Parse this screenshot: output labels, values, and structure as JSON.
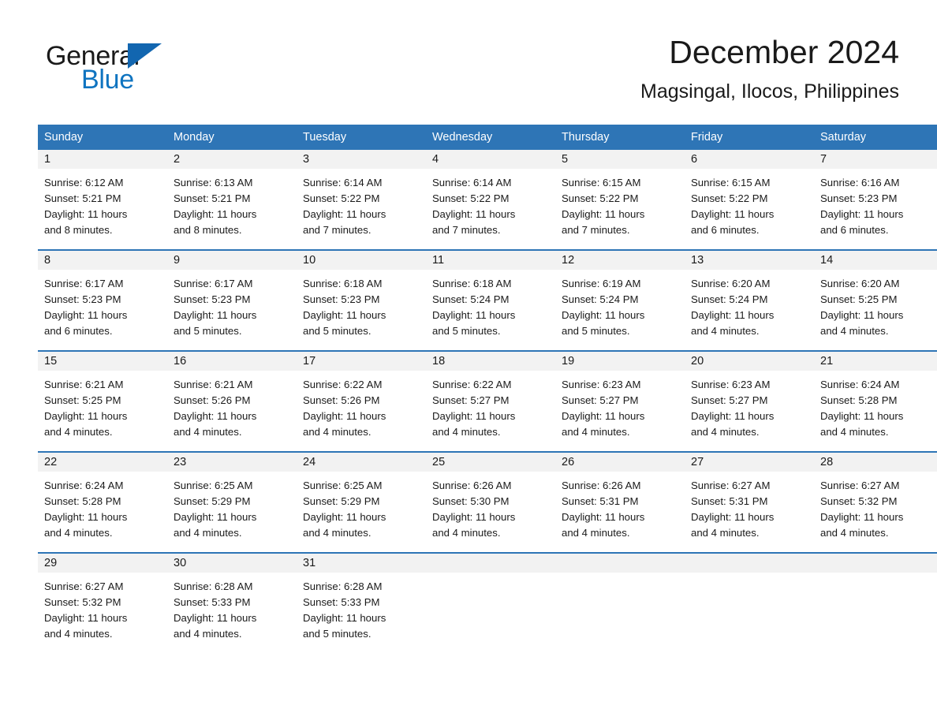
{
  "brand": {
    "name_part1": "General",
    "name_part2": "Blue",
    "triangle_color": "#1266b0",
    "blue_text_color": "#0f74c0"
  },
  "header": {
    "month_year": "December 2024",
    "location": "Magsingal, Ilocos, Philippines"
  },
  "theme": {
    "header_blue": "#2e75b6",
    "row_divider_blue": "#2e75b6",
    "daynum_band_gray": "#f2f2f2",
    "text_color": "#1a1a1a",
    "page_background": "#ffffff"
  },
  "calendar": {
    "weekday_headers": [
      "Sunday",
      "Monday",
      "Tuesday",
      "Wednesday",
      "Thursday",
      "Friday",
      "Saturday"
    ],
    "weeks": [
      [
        {
          "day": "1",
          "sunrise": "Sunrise: 6:12 AM",
          "sunset": "Sunset: 5:21 PM",
          "daylight_line1": "Daylight: 11 hours",
          "daylight_line2": "and 8 minutes."
        },
        {
          "day": "2",
          "sunrise": "Sunrise: 6:13 AM",
          "sunset": "Sunset: 5:21 PM",
          "daylight_line1": "Daylight: 11 hours",
          "daylight_line2": "and 8 minutes."
        },
        {
          "day": "3",
          "sunrise": "Sunrise: 6:14 AM",
          "sunset": "Sunset: 5:22 PM",
          "daylight_line1": "Daylight: 11 hours",
          "daylight_line2": "and 7 minutes."
        },
        {
          "day": "4",
          "sunrise": "Sunrise: 6:14 AM",
          "sunset": "Sunset: 5:22 PM",
          "daylight_line1": "Daylight: 11 hours",
          "daylight_line2": "and 7 minutes."
        },
        {
          "day": "5",
          "sunrise": "Sunrise: 6:15 AM",
          "sunset": "Sunset: 5:22 PM",
          "daylight_line1": "Daylight: 11 hours",
          "daylight_line2": "and 7 minutes."
        },
        {
          "day": "6",
          "sunrise": "Sunrise: 6:15 AM",
          "sunset": "Sunset: 5:22 PM",
          "daylight_line1": "Daylight: 11 hours",
          "daylight_line2": "and 6 minutes."
        },
        {
          "day": "7",
          "sunrise": "Sunrise: 6:16 AM",
          "sunset": "Sunset: 5:23 PM",
          "daylight_line1": "Daylight: 11 hours",
          "daylight_line2": "and 6 minutes."
        }
      ],
      [
        {
          "day": "8",
          "sunrise": "Sunrise: 6:17 AM",
          "sunset": "Sunset: 5:23 PM",
          "daylight_line1": "Daylight: 11 hours",
          "daylight_line2": "and 6 minutes."
        },
        {
          "day": "9",
          "sunrise": "Sunrise: 6:17 AM",
          "sunset": "Sunset: 5:23 PM",
          "daylight_line1": "Daylight: 11 hours",
          "daylight_line2": "and 5 minutes."
        },
        {
          "day": "10",
          "sunrise": "Sunrise: 6:18 AM",
          "sunset": "Sunset: 5:23 PM",
          "daylight_line1": "Daylight: 11 hours",
          "daylight_line2": "and 5 minutes."
        },
        {
          "day": "11",
          "sunrise": "Sunrise: 6:18 AM",
          "sunset": "Sunset: 5:24 PM",
          "daylight_line1": "Daylight: 11 hours",
          "daylight_line2": "and 5 minutes."
        },
        {
          "day": "12",
          "sunrise": "Sunrise: 6:19 AM",
          "sunset": "Sunset: 5:24 PM",
          "daylight_line1": "Daylight: 11 hours",
          "daylight_line2": "and 5 minutes."
        },
        {
          "day": "13",
          "sunrise": "Sunrise: 6:20 AM",
          "sunset": "Sunset: 5:24 PM",
          "daylight_line1": "Daylight: 11 hours",
          "daylight_line2": "and 4 minutes."
        },
        {
          "day": "14",
          "sunrise": "Sunrise: 6:20 AM",
          "sunset": "Sunset: 5:25 PM",
          "daylight_line1": "Daylight: 11 hours",
          "daylight_line2": "and 4 minutes."
        }
      ],
      [
        {
          "day": "15",
          "sunrise": "Sunrise: 6:21 AM",
          "sunset": "Sunset: 5:25 PM",
          "daylight_line1": "Daylight: 11 hours",
          "daylight_line2": "and 4 minutes."
        },
        {
          "day": "16",
          "sunrise": "Sunrise: 6:21 AM",
          "sunset": "Sunset: 5:26 PM",
          "daylight_line1": "Daylight: 11 hours",
          "daylight_line2": "and 4 minutes."
        },
        {
          "day": "17",
          "sunrise": "Sunrise: 6:22 AM",
          "sunset": "Sunset: 5:26 PM",
          "daylight_line1": "Daylight: 11 hours",
          "daylight_line2": "and 4 minutes."
        },
        {
          "day": "18",
          "sunrise": "Sunrise: 6:22 AM",
          "sunset": "Sunset: 5:27 PM",
          "daylight_line1": "Daylight: 11 hours",
          "daylight_line2": "and 4 minutes."
        },
        {
          "day": "19",
          "sunrise": "Sunrise: 6:23 AM",
          "sunset": "Sunset: 5:27 PM",
          "daylight_line1": "Daylight: 11 hours",
          "daylight_line2": "and 4 minutes."
        },
        {
          "day": "20",
          "sunrise": "Sunrise: 6:23 AM",
          "sunset": "Sunset: 5:27 PM",
          "daylight_line1": "Daylight: 11 hours",
          "daylight_line2": "and 4 minutes."
        },
        {
          "day": "21",
          "sunrise": "Sunrise: 6:24 AM",
          "sunset": "Sunset: 5:28 PM",
          "daylight_line1": "Daylight: 11 hours",
          "daylight_line2": "and 4 minutes."
        }
      ],
      [
        {
          "day": "22",
          "sunrise": "Sunrise: 6:24 AM",
          "sunset": "Sunset: 5:28 PM",
          "daylight_line1": "Daylight: 11 hours",
          "daylight_line2": "and 4 minutes."
        },
        {
          "day": "23",
          "sunrise": "Sunrise: 6:25 AM",
          "sunset": "Sunset: 5:29 PM",
          "daylight_line1": "Daylight: 11 hours",
          "daylight_line2": "and 4 minutes."
        },
        {
          "day": "24",
          "sunrise": "Sunrise: 6:25 AM",
          "sunset": "Sunset: 5:29 PM",
          "daylight_line1": "Daylight: 11 hours",
          "daylight_line2": "and 4 minutes."
        },
        {
          "day": "25",
          "sunrise": "Sunrise: 6:26 AM",
          "sunset": "Sunset: 5:30 PM",
          "daylight_line1": "Daylight: 11 hours",
          "daylight_line2": "and 4 minutes."
        },
        {
          "day": "26",
          "sunrise": "Sunrise: 6:26 AM",
          "sunset": "Sunset: 5:31 PM",
          "daylight_line1": "Daylight: 11 hours",
          "daylight_line2": "and 4 minutes."
        },
        {
          "day": "27",
          "sunrise": "Sunrise: 6:27 AM",
          "sunset": "Sunset: 5:31 PM",
          "daylight_line1": "Daylight: 11 hours",
          "daylight_line2": "and 4 minutes."
        },
        {
          "day": "28",
          "sunrise": "Sunrise: 6:27 AM",
          "sunset": "Sunset: 5:32 PM",
          "daylight_line1": "Daylight: 11 hours",
          "daylight_line2": "and 4 minutes."
        }
      ],
      [
        {
          "day": "29",
          "sunrise": "Sunrise: 6:27 AM",
          "sunset": "Sunset: 5:32 PM",
          "daylight_line1": "Daylight: 11 hours",
          "daylight_line2": "and 4 minutes."
        },
        {
          "day": "30",
          "sunrise": "Sunrise: 6:28 AM",
          "sunset": "Sunset: 5:33 PM",
          "daylight_line1": "Daylight: 11 hours",
          "daylight_line2": "and 4 minutes."
        },
        {
          "day": "31",
          "sunrise": "Sunrise: 6:28 AM",
          "sunset": "Sunset: 5:33 PM",
          "daylight_line1": "Daylight: 11 hours",
          "daylight_line2": "and 5 minutes."
        },
        {
          "day": "",
          "sunrise": "",
          "sunset": "",
          "daylight_line1": "",
          "daylight_line2": ""
        },
        {
          "day": "",
          "sunrise": "",
          "sunset": "",
          "daylight_line1": "",
          "daylight_line2": ""
        },
        {
          "day": "",
          "sunrise": "",
          "sunset": "",
          "daylight_line1": "",
          "daylight_line2": ""
        },
        {
          "day": "",
          "sunrise": "",
          "sunset": "",
          "daylight_line1": "",
          "daylight_line2": ""
        }
      ]
    ]
  }
}
